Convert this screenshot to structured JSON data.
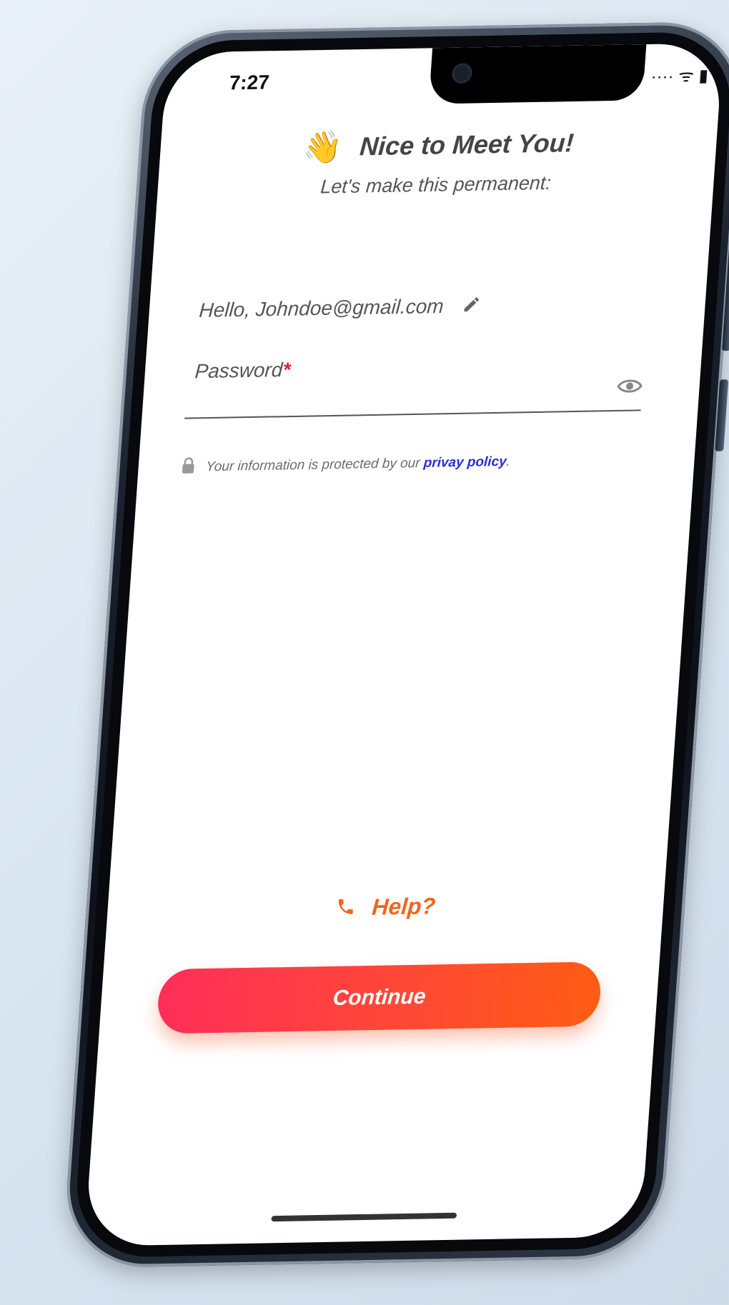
{
  "status_bar": {
    "time": "7:27",
    "icons": "···· ᯤ ▮"
  },
  "header": {
    "wave_icon": "waving-hand-icon",
    "title": "Nice to Meet You!",
    "subtitle": "Let's make this permanent:"
  },
  "account": {
    "greeting": "Hello, Johndoe@gmail.com",
    "edit_icon": "pencil-icon"
  },
  "password": {
    "label": "Password",
    "required_marker": "*",
    "toggle_icon": "eye-icon"
  },
  "privacy": {
    "text": "Your information is protected by our ",
    "link": "privay policy",
    "suffix": ".",
    "icon": "lock-icon"
  },
  "help": {
    "label": "Help?",
    "icon": "phone-icon"
  },
  "continue": {
    "label": "Continue"
  },
  "colors": {
    "accent_start": "#ff2e58",
    "accent_end": "#ff5c12",
    "help": "#f0661a",
    "link": "#2b2bd6"
  }
}
